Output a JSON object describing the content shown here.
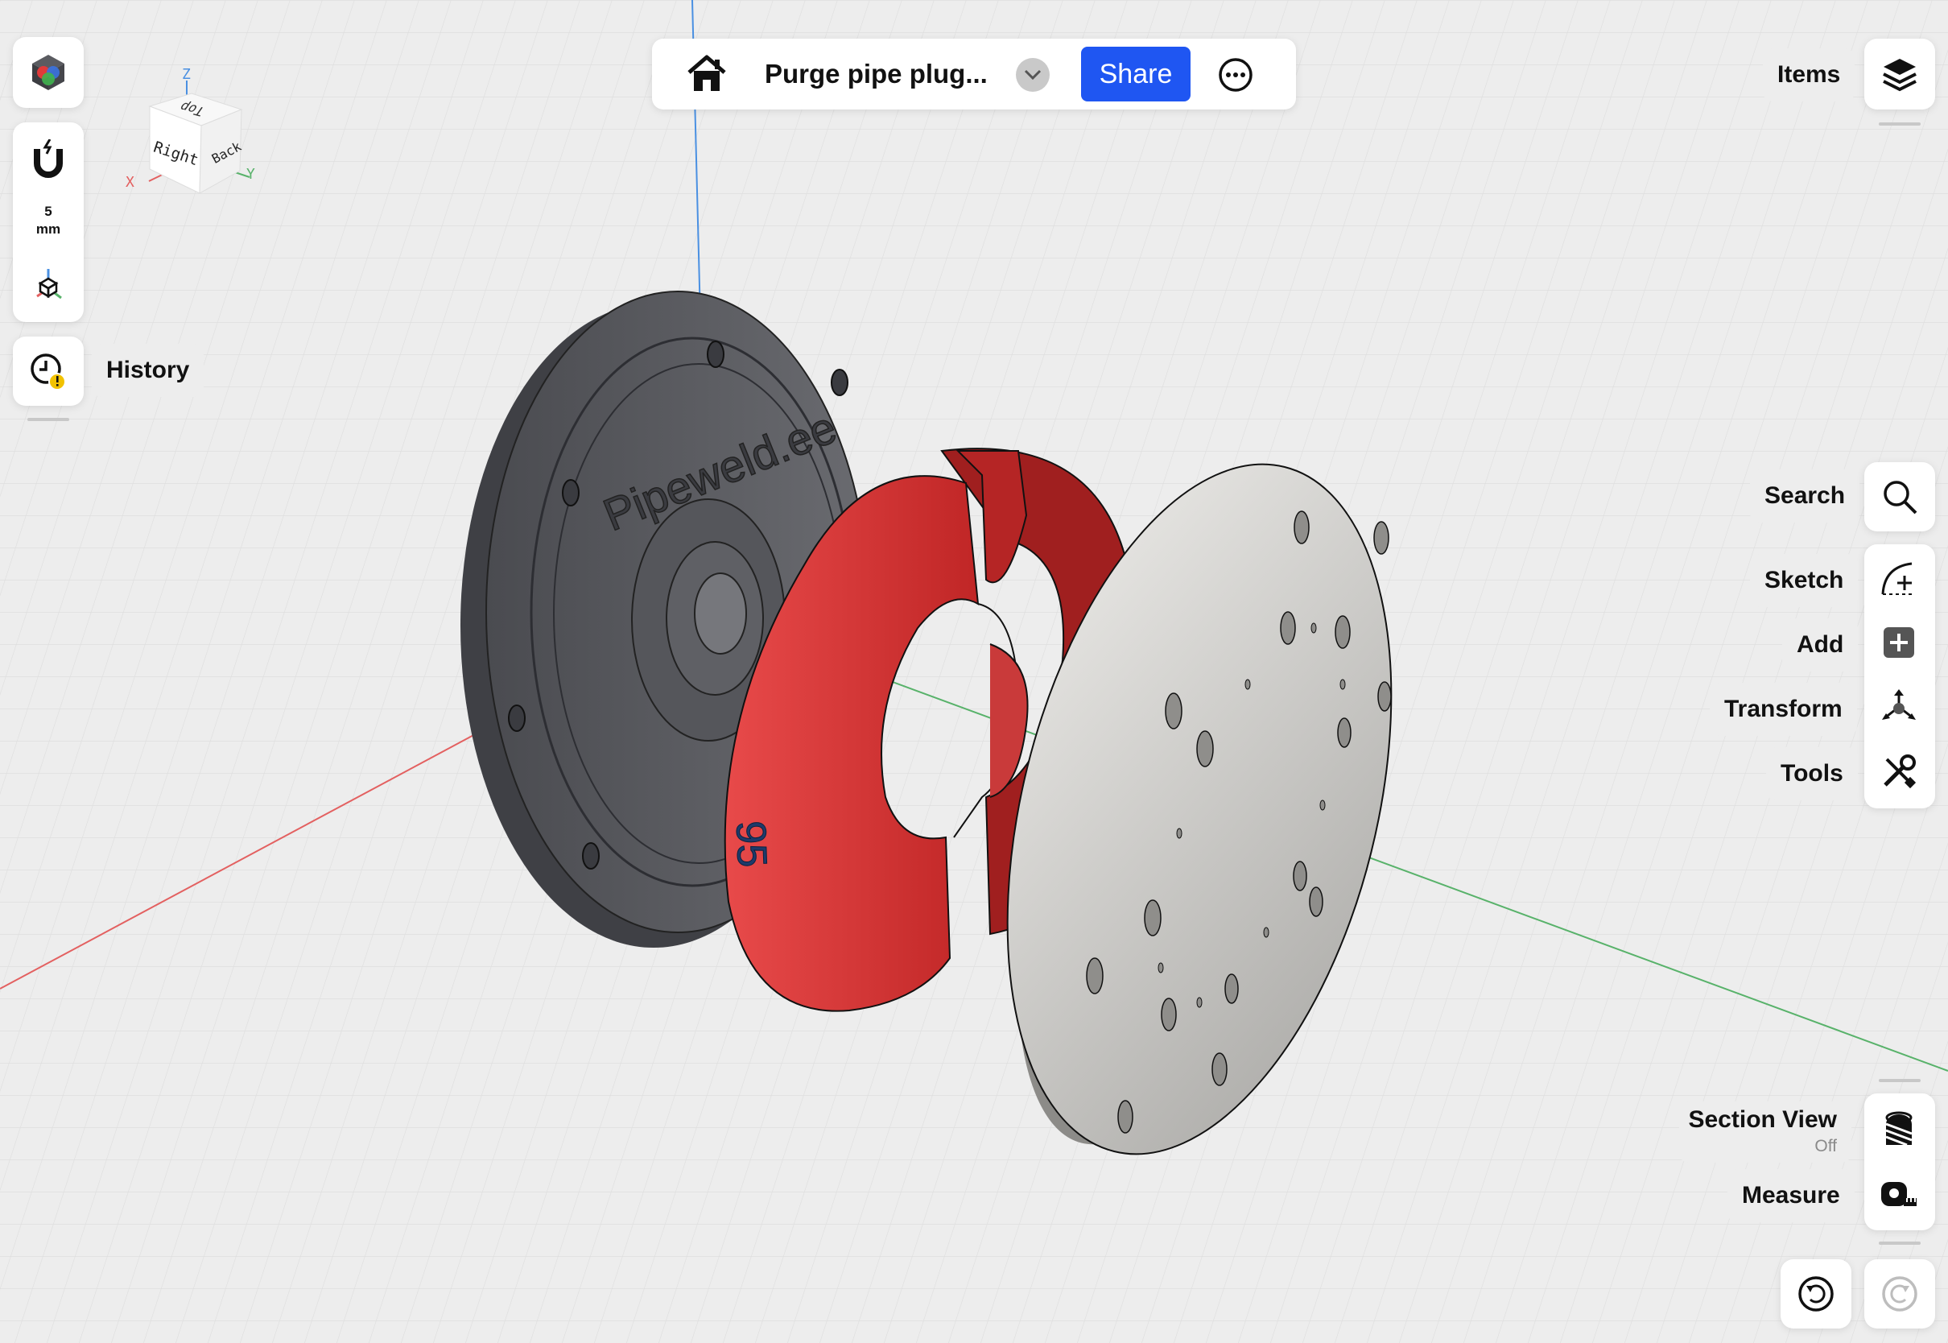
{
  "document": {
    "title": "Purge pipe plug...",
    "share_label": "Share"
  },
  "left_toolbar": {
    "snap_value": "5",
    "snap_unit": "mm",
    "history_label": "History"
  },
  "view_cube": {
    "faces": [
      "Top",
      "Right",
      "Back"
    ],
    "axes": [
      "X",
      "Y",
      "Z"
    ]
  },
  "right_toolbar": {
    "items_label": "Items",
    "search_label": "Search",
    "sketch_label": "Sketch",
    "add_label": "Add",
    "transform_label": "Transform",
    "tools_label": "Tools",
    "section_view_label": "Section View",
    "section_view_state": "Off",
    "measure_label": "Measure"
  },
  "model": {
    "engraving_text": "Pipeweld.ee",
    "size_text": "95"
  },
  "colors": {
    "accent": "#1f56f2",
    "part_dark": "#5a5b60",
    "part_red": "#d62f2f",
    "part_light": "#d9d8d5",
    "axis_x": "#e36060",
    "axis_y": "#58b26a",
    "axis_z": "#4a90e2"
  }
}
